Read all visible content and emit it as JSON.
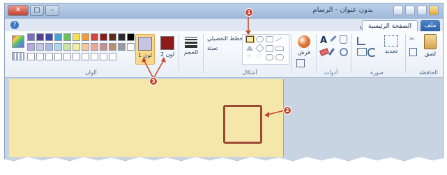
{
  "window": {
    "close_glyph": "✕",
    "maximize_glyph": "□",
    "minimize_glyph": "–",
    "title": "بدون عنوان - الرسام"
  },
  "tabs": {
    "help_glyph": "?",
    "view": "عرض",
    "home": "الصفحة الرئيسية",
    "file": "ملف"
  },
  "ribbon": {
    "colors_label": "ألوان",
    "shapes_label": "أشكال",
    "tools_label": "أدوات",
    "image_label": "صورة",
    "clipboard_label": "الحافظة",
    "size_label": "الحجم",
    "color1_label": "لون 1",
    "color2_label": "لون 2",
    "outline_label": "المخطط التفصيلي",
    "fill_label": "تعبئة",
    "select_label": "تحديد",
    "paste_label": "لصق",
    "brushes_label": "فرش",
    "text_glyph": "A"
  },
  "palette": {
    "row1": [
      "#7d6bbf",
      "#5b3f8f",
      "#3f49a8",
      "#4aa0d8",
      "#6ac05a",
      "#f7e04a",
      "#f29b3b",
      "#d9423a",
      "#8c1b1b",
      "#5a2e1a",
      "#2b2b2b",
      "#000000"
    ],
    "row2": [
      "#b8a8e0",
      "#c7c7e8",
      "#a8b8e0",
      "#a9d8ef",
      "#c8e6a0",
      "#f5ee9a",
      "#f6c79b",
      "#f1a49a",
      "#c98f8f",
      "#b5916b",
      "#9a9a9a",
      "#ffffff"
    ],
    "row3": [
      "#ffffff",
      "#ffffff",
      "#ffffff",
      "#ffffff",
      "#ffffff",
      "#ffffff",
      "#ffffff",
      "#ffffff",
      "#ffffff",
      "#ffffff"
    ]
  },
  "selected_colors": {
    "color1": "#c9c3e2",
    "color2": "#8e1a1a"
  },
  "callouts": {
    "one": "1",
    "two": "2",
    "three": "3"
  },
  "colors": {
    "accent": "#c4452c",
    "canvas": "#f5e6a9",
    "shape_outline": "#9a4a35"
  }
}
